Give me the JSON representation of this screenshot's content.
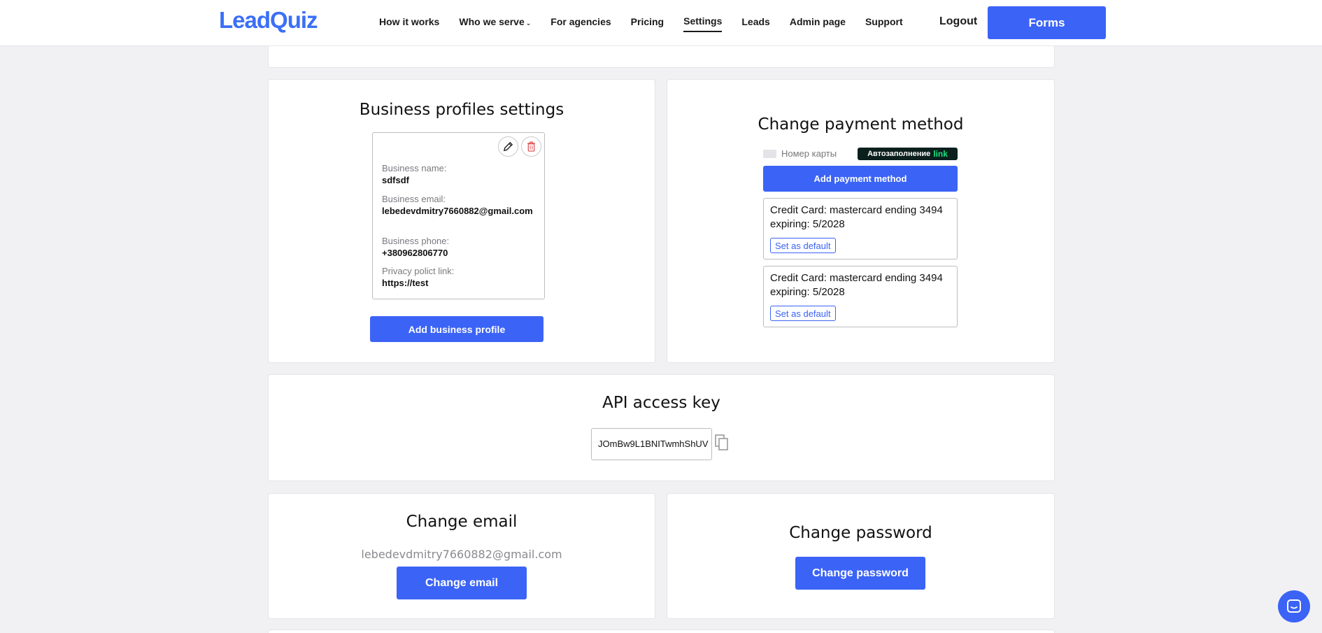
{
  "header": {
    "logo": "LeadQuiz",
    "nav": [
      {
        "label": "How it works"
      },
      {
        "label": "Who we serve",
        "dropdown": true
      },
      {
        "label": "For agencies"
      },
      {
        "label": "Pricing"
      },
      {
        "label": "Settings",
        "active": true
      },
      {
        "label": "Leads"
      },
      {
        "label": "Admin page"
      },
      {
        "label": "Support"
      }
    ],
    "logout": "Logout",
    "forms": "Forms"
  },
  "business": {
    "title": "Business profiles settings",
    "profile": {
      "name_label": "Business name:",
      "name": "sdfsdf",
      "email_label": "Business email:",
      "email": "lebedevdmitry7660882@gmail.com",
      "phone_label": "Business phone:",
      "phone": "+380962806770",
      "privacy_label": "Privacy polict link:",
      "privacy": "https://test"
    },
    "add_button": "Add business profile"
  },
  "payment": {
    "title": "Change payment method",
    "card_placeholder": "Номер карты",
    "autofill": "Автозаполнение",
    "autofill_link": "link",
    "add_button": "Add payment method",
    "cards": [
      {
        "text": "Credit Card: mastercard ending 3494 expiring: 5/2028",
        "default_button": "Set as default"
      },
      {
        "text": "Credit Card: mastercard ending 3494 expiring: 5/2028",
        "default_button": "Set as default"
      }
    ]
  },
  "api": {
    "title": "API access key",
    "key": "JOmBw9L1BNITwmhShUV"
  },
  "email": {
    "title": "Change email",
    "current": "lebedevdmitry7660882@gmail.com",
    "button": "Change email"
  },
  "password": {
    "title": "Change password",
    "button": "Change password"
  },
  "colors": {
    "brand": "#3b63f6",
    "background": "#f1f1f3",
    "link_green": "#19e27b"
  },
  "icons": [
    "pencil-icon",
    "trash-icon",
    "card-icon",
    "copy-icon",
    "chat-icon",
    "chevron-down-icon"
  ]
}
